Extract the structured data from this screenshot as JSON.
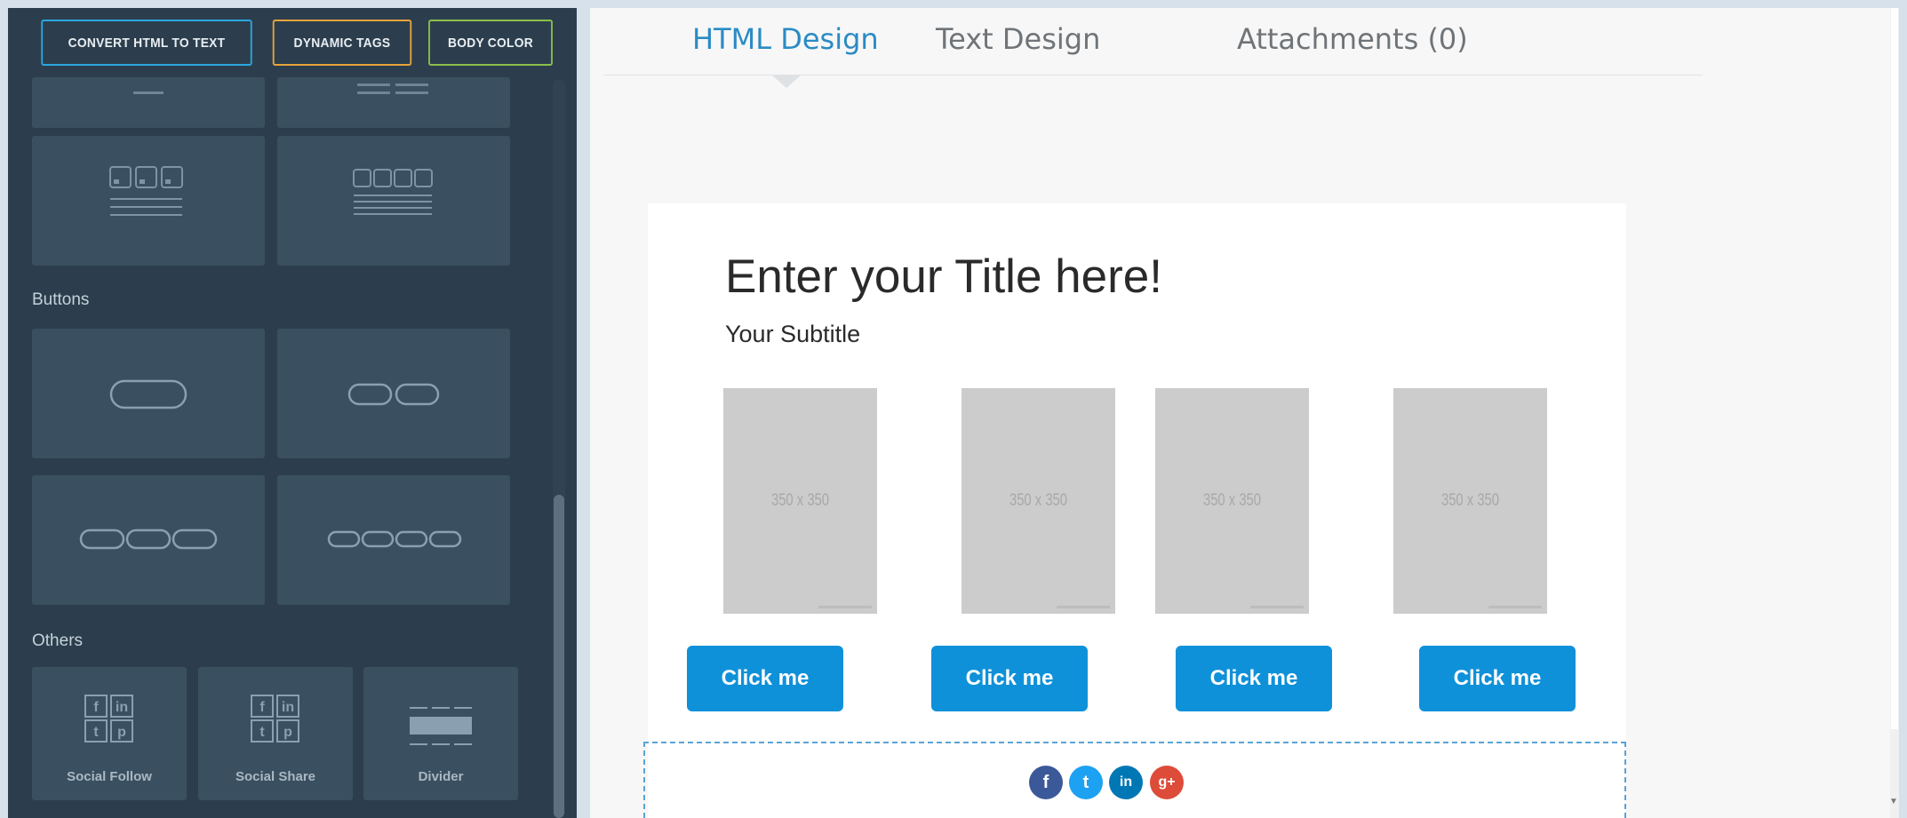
{
  "toolbar": {
    "convert_label": "CONVERT HTML TO TEXT",
    "dynamic_tags_label": "DYNAMIC TAGS",
    "body_color_label": "BODY COLOR"
  },
  "sidebar": {
    "sections": {
      "buttons": "Buttons",
      "others": "Others"
    },
    "others_tiles": {
      "social_follow": "Social Follow",
      "social_share": "Social Share",
      "divider": "Divider"
    }
  },
  "tabs": {
    "html_design": "HTML Design",
    "text_design": "Text Design",
    "attachments": "Attachments (0)"
  },
  "email": {
    "title": "Enter your Title here!",
    "subtitle": "Your Subtitle",
    "images": [
      "350 x 350",
      "350 x 350",
      "350 x 350",
      "350 x 350"
    ],
    "buttons": [
      "Click me",
      "Click me",
      "Click me",
      "Click me"
    ],
    "social_icons": [
      "facebook-icon",
      "twitter-icon",
      "linkedin-icon",
      "google-plus-icon"
    ],
    "social_glyphs": [
      "f",
      "t",
      "in",
      "g+"
    ]
  },
  "colors": {
    "sidebar_bg": "#2c3e4d",
    "tile_bg": "#3a4f5f",
    "convert_border": "#2ba7df",
    "dynamic_border": "#e8a33b",
    "body_color_border": "#8ac04a",
    "active_tab": "#2b8bc4",
    "button_blue": "#0f91d9",
    "facebook": "#3b5998",
    "twitter": "#1da1f2",
    "linkedin": "#0077b5",
    "google_plus": "#dd4b39"
  }
}
